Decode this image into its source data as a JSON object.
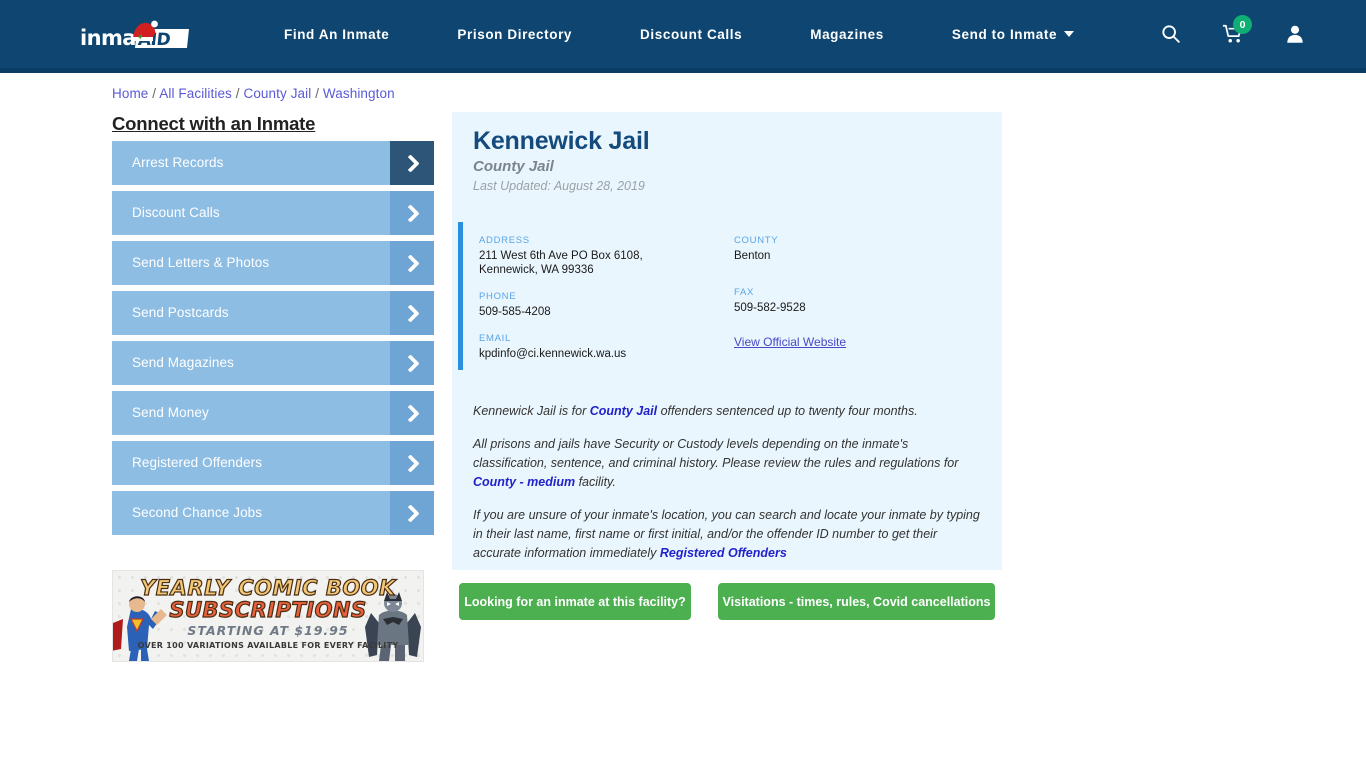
{
  "header": {
    "logo": {
      "text": "inmate",
      "badge": "AID",
      "icon": "santa-hat-icon"
    },
    "nav": [
      {
        "label": "Find An Inmate",
        "dropdown": false
      },
      {
        "label": "Prison Directory",
        "dropdown": false
      },
      {
        "label": "Discount Calls",
        "dropdown": false
      },
      {
        "label": "Magazines",
        "dropdown": false
      },
      {
        "label": "Send to Inmate",
        "dropdown": true
      }
    ],
    "icons": [
      {
        "name": "search-icon"
      },
      {
        "name": "cart-icon",
        "badge": "0",
        "badge_color": "#0fae72"
      },
      {
        "name": "account-icon"
      }
    ],
    "background_color": "#0e4671"
  },
  "breadcrumb": {
    "items": [
      "Home",
      "All Facilities",
      "County Jail",
      "Washington"
    ],
    "separator": "/"
  },
  "sidebar": {
    "title": "Connect with an Inmate",
    "items": [
      {
        "label": "Arrest Records",
        "active": true
      },
      {
        "label": "Discount Calls",
        "active": false
      },
      {
        "label": "Send Letters & Photos",
        "active": false
      },
      {
        "label": "Send Postcards",
        "active": false
      },
      {
        "label": "Send Magazines",
        "active": false
      },
      {
        "label": "Send Money",
        "active": false
      },
      {
        "label": "Registered Offenders",
        "active": false
      },
      {
        "label": "Second Chance Jobs",
        "active": false
      }
    ]
  },
  "ad": {
    "line1": "YEARLY COMIC BOOK",
    "line2": "SUBSCRIPTIONS",
    "line3": "STARTING AT $19.95",
    "line4": "OVER 100 VARIATIONS AVAILABLE FOR EVERY FACILITY"
  },
  "facility": {
    "name": "Kennewick Jail",
    "type": "County Jail",
    "last_updated": "Last Updated: August 28, 2019",
    "fields": {
      "address_label": "ADDRESS",
      "address_line1": "211 West 6th Ave PO Box 6108,",
      "address_line2": "Kennewick, WA 99336",
      "phone_label": "PHONE",
      "phone_value": "509-585-4208",
      "email_label": "EMAIL",
      "email_value": "kpdinfo@ci.kennewick.wa.us",
      "county_label": "COUNTY",
      "county_value": "Benton",
      "fax_label": "FAX",
      "fax_value": "509-582-9528",
      "website_link": "View Official Website"
    },
    "paragraphs": {
      "p1_a": "Kennewick Jail is for ",
      "p1_link": "County Jail",
      "p1_b": " offenders sentenced up to twenty four months.",
      "p2_a": "All prisons and jails have Security or Custody levels depending on the inmate's classification, sentence, and criminal history. Please review the rules and regulations for ",
      "p2_link": "County - medium",
      "p2_b": " facility.",
      "p3_a": "If you are unsure of your inmate's location, you can search and locate your inmate by typing in their last name, first name or first initial, and/or the offender ID number to get their accurate information immediately ",
      "p3_link": "Registered Offenders"
    }
  },
  "actions": {
    "looking": "Looking for an inmate at this facility?",
    "visitations": "Visitations - times, rules, Covid cancellations",
    "color": "#4caf50"
  }
}
